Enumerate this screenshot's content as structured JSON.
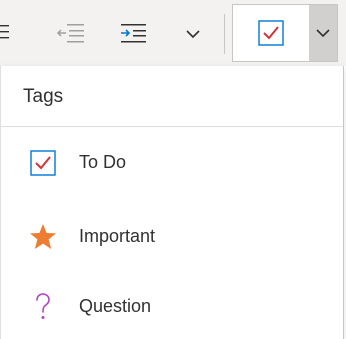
{
  "toolbar": {
    "list_icon": "bulleted-list-icon",
    "decrease_indent_icon": "decrease-indent-icon",
    "increase_indent_icon": "increase-indent-icon",
    "more_icon": "chevron-down-icon",
    "current_tag_icon": "todo-checkbox-icon",
    "tag_dropdown_icon": "chevron-down-icon"
  },
  "colors": {
    "toolbar_bg": "#f3f2f1",
    "accent_blue": "#0078d4",
    "check_red": "#d13438",
    "star_orange": "#ed7d31",
    "question_purple": "#b146c2"
  },
  "menu": {
    "header": "Tags",
    "items": [
      {
        "label": "To Do",
        "icon": "todo-checkbox-icon"
      },
      {
        "label": "Important",
        "icon": "star-icon"
      },
      {
        "label": "Question",
        "icon": "question-mark-icon"
      }
    ]
  }
}
